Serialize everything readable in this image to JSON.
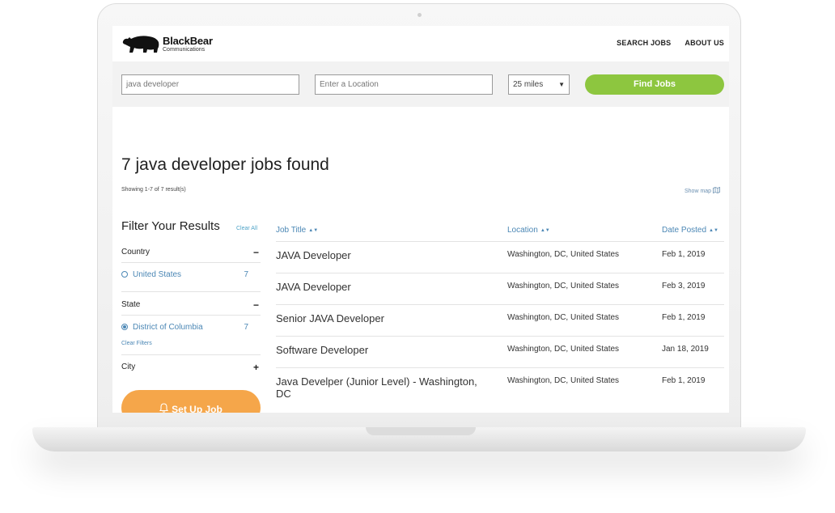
{
  "brand": {
    "name": "BlackBear",
    "subtitle": "Communications",
    "logo_icon": "bear-icon"
  },
  "nav": {
    "items": [
      "SEARCH JOBS",
      "ABOUT US"
    ]
  },
  "search": {
    "keyword_value": "java developer",
    "location_placeholder": "Enter a Location",
    "radius_value": "25 miles",
    "find_button": "Find Jobs"
  },
  "results": {
    "title": "7 java developer jobs found",
    "count_text": "Showing 1-7 of 7 result(s)",
    "show_map": "Show map"
  },
  "filters": {
    "title": "Filter Your Results",
    "clear_all": "Clear All",
    "groups": [
      {
        "name": "Country",
        "toggle": "−",
        "options": [
          {
            "label": "United States",
            "count": "7",
            "selected": false
          }
        ]
      },
      {
        "name": "State",
        "toggle": "−",
        "options": [
          {
            "label": "District of Columbia",
            "count": "7",
            "selected": true
          }
        ]
      },
      {
        "name": "City",
        "toggle": "+",
        "options": []
      }
    ],
    "clear_filters": "Clear Filters",
    "setup_button": "Set Up Job"
  },
  "table": {
    "columns": [
      "Job Title",
      "Location",
      "Date Posted"
    ],
    "sort_glyph": "▲▼",
    "rows": [
      {
        "title": "JAVA Developer",
        "location": "Washington, DC, United States",
        "date": "Feb 1, 2019"
      },
      {
        "title": "JAVA Developer",
        "location": "Washington, DC, United States",
        "date": "Feb 3, 2019"
      },
      {
        "title": "Senior JAVA Developer",
        "location": "Washington, DC, United States",
        "date": "Feb 1, 2019"
      },
      {
        "title": "Software Developer",
        "location": "Washington, DC, United States",
        "date": "Jan 18, 2019"
      },
      {
        "title": "Java Develper (Junior Level) - Washington, DC",
        "location": "Washington, DC, United States",
        "date": "Feb 1, 2019"
      }
    ]
  },
  "colors": {
    "accent_green": "#8dc63f",
    "accent_orange": "#f5a64a",
    "link_blue": "#4b87b5"
  }
}
